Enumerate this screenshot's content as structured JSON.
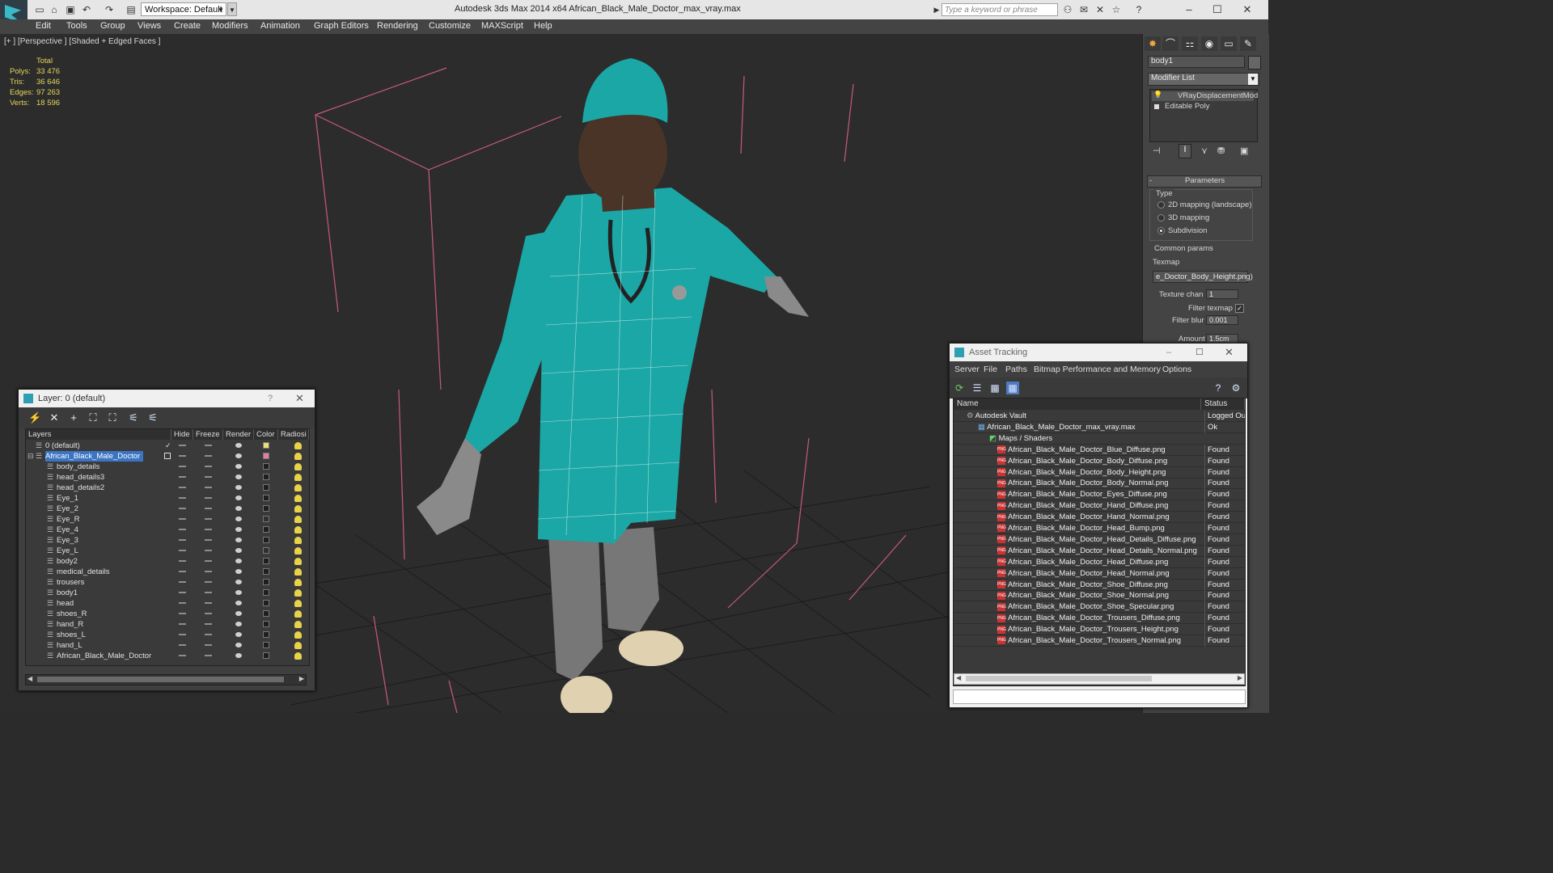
{
  "app": {
    "title": "Autodesk 3ds Max  2014 x64     African_Black_Male_Doctor_max_vray.max",
    "workspace": "Workspace: Default",
    "search_placeholder": "Type a keyword or phrase"
  },
  "menu": [
    "Edit",
    "Tools",
    "Group",
    "Views",
    "Create",
    "Modifiers",
    "Animation",
    "Graph Editors",
    "Rendering",
    "Customize",
    "MAXScript",
    "Help"
  ],
  "viewport": {
    "label": "[+ ] [Perspective ] [Shaded + Edged Faces ]",
    "stats": {
      "header": "Total",
      "rows": [
        {
          "k": "Polys:",
          "v": "33 476"
        },
        {
          "k": "Tris:",
          "v": "36 646"
        },
        {
          "k": "Edges:",
          "v": "97 263"
        },
        {
          "k": "Verts:",
          "v": "18 596"
        }
      ]
    }
  },
  "command_panel": {
    "object_name": "body1",
    "modifier_list": "Modifier List",
    "stack": [
      "VRayDisplacementMod",
      "Editable Poly"
    ],
    "rollout_title": "Parameters",
    "type_label": "Type",
    "type_options": [
      "2D mapping (landscape)",
      "3D mapping",
      "Subdivision"
    ],
    "common_params": "Common params",
    "texmap_label": "Texmap",
    "texmap_value": "e_Doctor_Body_Height.png)",
    "texture_chan_label": "Texture chan",
    "texture_chan_value": "1",
    "filter_texmap": "Filter texmap",
    "filter_blur_label": "Filter blur",
    "filter_blur_value": "0.001",
    "amount_label": "Amount",
    "amount_value": "1.5cm"
  },
  "layer_window": {
    "title": "Layer: 0 (default)",
    "help": "?",
    "columns": [
      "Layers",
      "Hide",
      "Freeze",
      "Render",
      "Color",
      "Radiosi"
    ],
    "rows": [
      {
        "name": "0 (default)",
        "indent": 1,
        "color": "#e8e070",
        "check": true
      },
      {
        "name": "African_Black_Male_Doctor",
        "indent": 1,
        "color": "#e87aa8",
        "selected": true
      },
      {
        "name": "body_details",
        "indent": 2,
        "color": "#1e1e1e"
      },
      {
        "name": "head_details3",
        "indent": 2,
        "color": "#1e1e1e"
      },
      {
        "name": "head_details2",
        "indent": 2,
        "color": "#1e1e1e"
      },
      {
        "name": "Eye_1",
        "indent": 2,
        "color": "#1e1e1e"
      },
      {
        "name": "Eye_2",
        "indent": 2,
        "color": "#1e1e1e"
      },
      {
        "name": "Eye_R",
        "indent": 2,
        "color": "#2f2f2f"
      },
      {
        "name": "Eye_4",
        "indent": 2,
        "color": "#1e1e1e"
      },
      {
        "name": "Eye_3",
        "indent": 2,
        "color": "#1e1e1e"
      },
      {
        "name": "Eye_L",
        "indent": 2,
        "color": "#2f2f2f"
      },
      {
        "name": "body2",
        "indent": 2,
        "color": "#1e1e1e"
      },
      {
        "name": "medical_details",
        "indent": 2,
        "color": "#1e1e1e"
      },
      {
        "name": "trousers",
        "indent": 2,
        "color": "#1e1e1e"
      },
      {
        "name": "body1",
        "indent": 2,
        "color": "#1e1e1e"
      },
      {
        "name": "head",
        "indent": 2,
        "color": "#1e1e1e"
      },
      {
        "name": "shoes_R",
        "indent": 2,
        "color": "#1e1e1e"
      },
      {
        "name": "hand_R",
        "indent": 2,
        "color": "#1e1e1e"
      },
      {
        "name": "shoes_L",
        "indent": 2,
        "color": "#1e1e1e"
      },
      {
        "name": "hand_L",
        "indent": 2,
        "color": "#1e1e1e"
      },
      {
        "name": "African_Black_Male_Doctor",
        "indent": 2,
        "color": "#1e1e1e"
      }
    ]
  },
  "asset_window": {
    "title": "Asset Tracking",
    "menu": [
      "Server",
      "File",
      "Paths",
      "Bitmap Performance and Memory",
      "Options"
    ],
    "columns": [
      "Name",
      "Status"
    ],
    "rows": [
      {
        "name": "Autodesk Vault",
        "status": "Logged Ou",
        "indent": 0,
        "icon": "vault"
      },
      {
        "name": "African_Black_Male_Doctor_max_vray.max",
        "status": "Ok",
        "indent": 1,
        "icon": "max"
      },
      {
        "name": "Maps / Shaders",
        "status": "",
        "indent": 2,
        "icon": "maps"
      },
      {
        "name": "African_Black_Male_Doctor_Blue_Diffuse.png",
        "status": "Found",
        "indent": 3,
        "icon": "png"
      },
      {
        "name": "African_Black_Male_Doctor_Body_Diffuse.png",
        "status": "Found",
        "indent": 3,
        "icon": "png"
      },
      {
        "name": "African_Black_Male_Doctor_Body_Height.png",
        "status": "Found",
        "indent": 3,
        "icon": "png"
      },
      {
        "name": "African_Black_Male_Doctor_Body_Normal.png",
        "status": "Found",
        "indent": 3,
        "icon": "png"
      },
      {
        "name": "African_Black_Male_Doctor_Eyes_Diffuse.png",
        "status": "Found",
        "indent": 3,
        "icon": "png"
      },
      {
        "name": "African_Black_Male_Doctor_Hand_Diffuse.png",
        "status": "Found",
        "indent": 3,
        "icon": "png"
      },
      {
        "name": "African_Black_Male_Doctor_Hand_Normal.png",
        "status": "Found",
        "indent": 3,
        "icon": "png"
      },
      {
        "name": "African_Black_Male_Doctor_Head_Bump.png",
        "status": "Found",
        "indent": 3,
        "icon": "png"
      },
      {
        "name": "African_Black_Male_Doctor_Head_Details_Diffuse.png",
        "status": "Found",
        "indent": 3,
        "icon": "png"
      },
      {
        "name": "African_Black_Male_Doctor_Head_Details_Normal.png",
        "status": "Found",
        "indent": 3,
        "icon": "png"
      },
      {
        "name": "African_Black_Male_Doctor_Head_Diffuse.png",
        "status": "Found",
        "indent": 3,
        "icon": "png"
      },
      {
        "name": "African_Black_Male_Doctor_Head_Normal.png",
        "status": "Found",
        "indent": 3,
        "icon": "png"
      },
      {
        "name": "African_Black_Male_Doctor_Shoe_Diffuse.png",
        "status": "Found",
        "indent": 3,
        "icon": "png"
      },
      {
        "name": "African_Black_Male_Doctor_Shoe_Normal.png",
        "status": "Found",
        "indent": 3,
        "icon": "png"
      },
      {
        "name": "African_Black_Male_Doctor_Shoe_Specular.png",
        "status": "Found",
        "indent": 3,
        "icon": "png"
      },
      {
        "name": "African_Black_Male_Doctor_Trousers_Diffuse.png",
        "status": "Found",
        "indent": 3,
        "icon": "png"
      },
      {
        "name": "African_Black_Male_Doctor_Trousers_Height.png",
        "status": "Found",
        "indent": 3,
        "icon": "png"
      },
      {
        "name": "African_Black_Male_Doctor_Trousers_Normal.png",
        "status": "Found",
        "indent": 3,
        "icon": "png"
      }
    ]
  },
  "colors": {
    "scrubs": "#1aa7a5",
    "skin": "#4a3428",
    "grid": "#1b1b1b",
    "bbox": "#d0607f",
    "stats": "#e6d45a",
    "selection": "#3b74c3"
  }
}
